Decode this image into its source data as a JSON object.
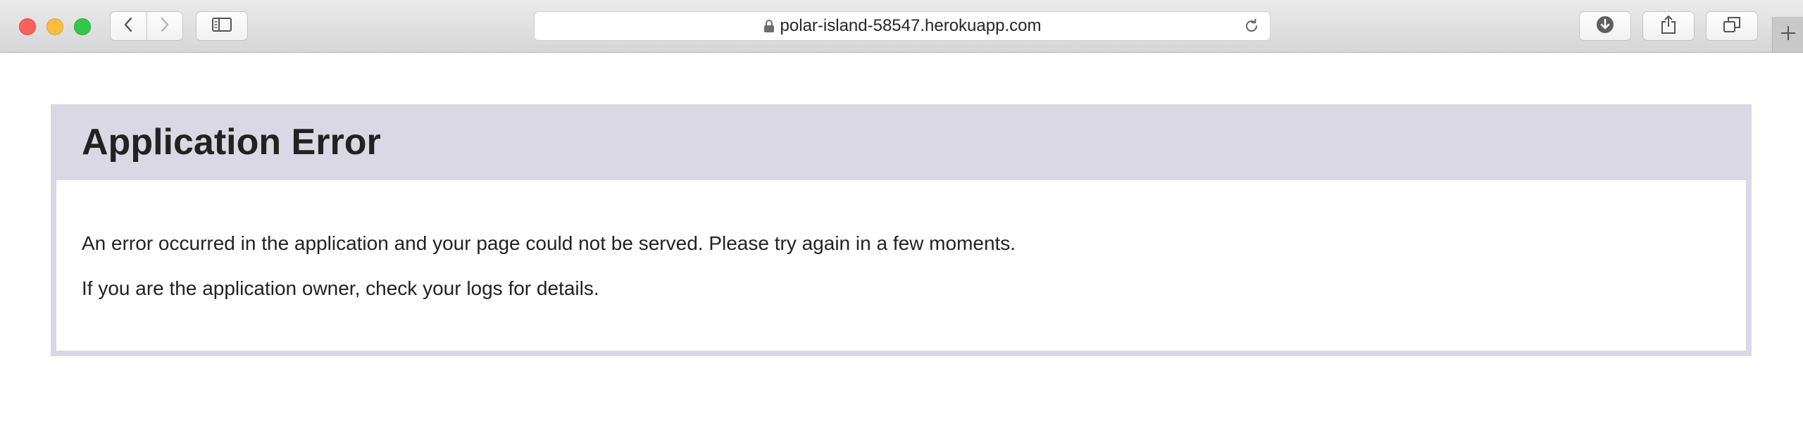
{
  "browser": {
    "url": "polar-island-58547.herokuapp.com",
    "icons": {
      "back": "chevron-left-icon",
      "forward": "chevron-right-icon",
      "sidebar": "sidebar-icon",
      "lock": "lock-icon",
      "reload": "reload-icon",
      "download": "download-icon",
      "share": "share-icon",
      "tabs": "tabs-icon",
      "new_tab": "plus-icon"
    }
  },
  "page": {
    "title": "Application Error",
    "message": "An error occurred in the application and your page could not be served. Please try again in a few moments.",
    "owner_note": "If you are the application owner, check your logs for details."
  },
  "colors": {
    "header_bg": "#dad8e4",
    "text": "#222222"
  }
}
